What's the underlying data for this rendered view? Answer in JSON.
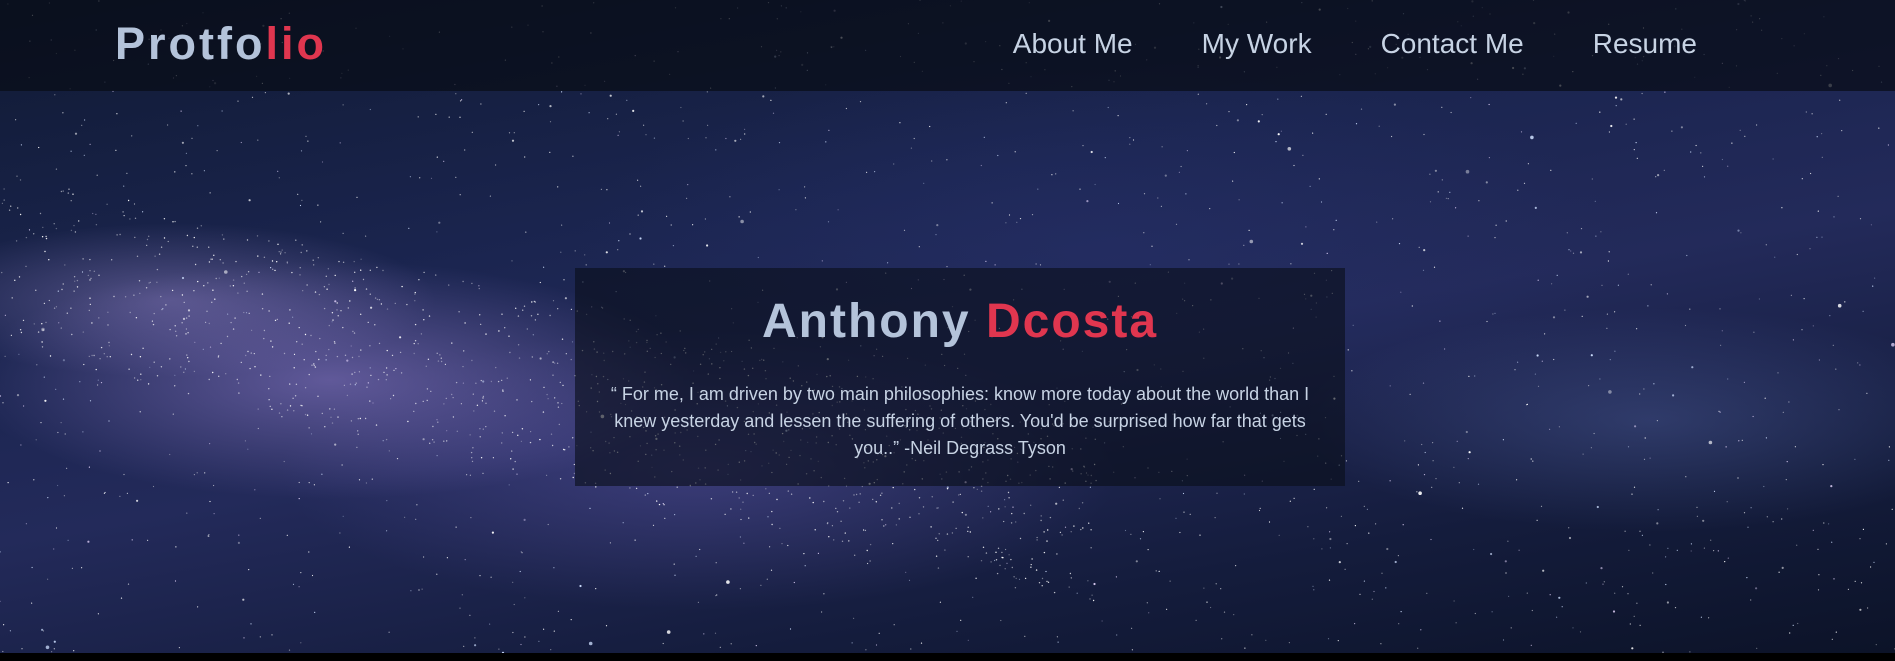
{
  "navbar": {
    "logo_part1": "Protfo",
    "logo_part2": "lio",
    "links": [
      "About Me",
      "My Work",
      "Contact Me",
      "Resume"
    ]
  },
  "hero": {
    "first_name": "Anthony",
    "last_name": "Dcosta",
    "quote": "“ For me, I am driven by two main philosophies: know more today about the world than I knew yesterday and lessen the suffering of others. You'd be surprised how far that gets you..” -Neil Degrass Tyson"
  },
  "colors": {
    "accent": "#e0364f",
    "text_light": "#b4c3da",
    "nav_text": "#c7d3e4",
    "page_bg": "#000000"
  }
}
